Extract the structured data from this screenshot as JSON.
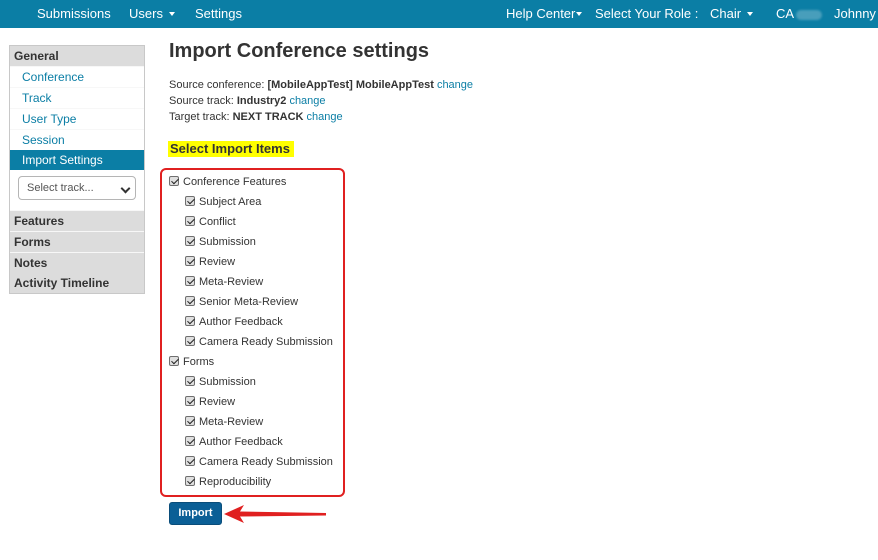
{
  "nav": {
    "left": [
      "Submissions",
      "Users",
      "Settings"
    ],
    "help_center": "Help Center",
    "role_label": "Select Your Role :",
    "role_value": "Chair",
    "conf_abbrev": "CA",
    "user": "Johnny"
  },
  "sidebar": {
    "general": "General",
    "links": [
      "Conference",
      "Track",
      "User Type",
      "Session",
      "Import Settings"
    ],
    "select_placeholder": "Select track...",
    "sections": [
      "Features",
      "Forms",
      "Notes",
      "Activity Timeline"
    ]
  },
  "main": {
    "title": "Import Conference settings",
    "source_conf_label": "Source conference: ",
    "source_conf_value": "[MobileAppTest] MobileAppTest",
    "source_track_label": "Source track: ",
    "source_track_value": "Industry2",
    "target_track_label": "Target track: ",
    "target_track_value": "NEXT TRACK",
    "change": "change",
    "select_items_heading": "Select Import Items",
    "conference_features": "Conference Features",
    "conference_feature_items": [
      "Subject Area",
      "Conflict",
      "Submission",
      "Review",
      "Meta-Review",
      "Senior Meta-Review",
      "Author Feedback",
      "Camera Ready Submission"
    ],
    "forms": "Forms",
    "form_items": [
      "Submission",
      "Review",
      "Meta-Review",
      "Author Feedback",
      "Camera Ready Submission",
      "Reproducibility"
    ],
    "import_button": "Import"
  },
  "colors": {
    "nav_bg": "#0b7ea5",
    "link": "#0b7ea5",
    "button": "#0b5f96",
    "highlight": "#ffff00",
    "annotation_red": "#e02020"
  }
}
